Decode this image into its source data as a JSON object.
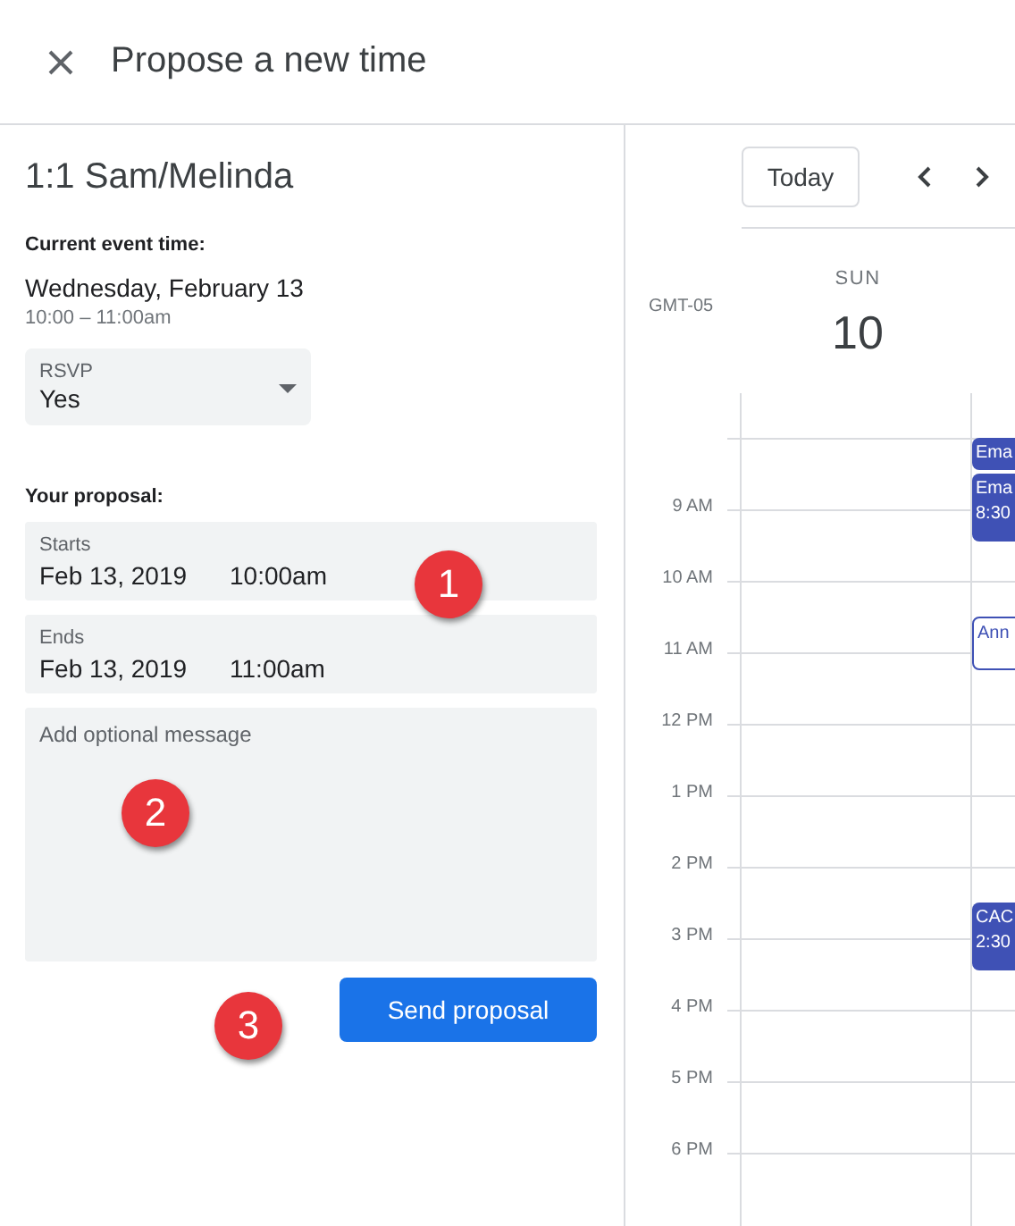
{
  "header": {
    "title": "Propose a new time"
  },
  "event": {
    "title": "1:1 Sam/Melinda",
    "current_label": "Current event time:",
    "date": "Wednesday, February 13",
    "time": "10:00 – 11:00am"
  },
  "rsvp": {
    "label": "RSVP",
    "value": "Yes"
  },
  "proposal": {
    "label": "Your proposal:",
    "fields": [
      {
        "label": "Starts",
        "date": "Feb 13, 2019",
        "time": "10:00am"
      },
      {
        "label": "Ends",
        "date": "Feb 13, 2019",
        "time": "11:00am"
      }
    ],
    "message": {
      "placeholder": "Add optional message"
    },
    "send_button": "Send proposal"
  },
  "callouts": [
    "1",
    "2",
    "3"
  ],
  "calendar": {
    "today_button": "Today",
    "timezone": "GMT-05",
    "day": {
      "weekday": "SUN",
      "date": "10"
    },
    "hours": [
      "9 AM",
      "10 AM",
      "11 AM",
      "12 PM",
      "1 PM",
      "2 PM",
      "3 PM",
      "4 PM",
      "5 PM",
      "6 PM"
    ],
    "events": [
      {
        "title": "Ema",
        "outlined": false
      },
      {
        "title": "Ema",
        "time": "8:30",
        "outlined": false
      },
      {
        "title": "Ann",
        "outlined": true
      },
      {
        "title": "CAC",
        "time": "2:30",
        "outlined": false
      }
    ]
  }
}
